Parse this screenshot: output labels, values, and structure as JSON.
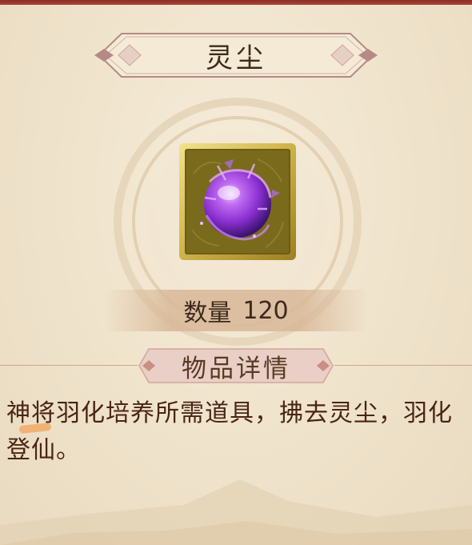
{
  "item": {
    "name": "灵尘",
    "quantity_label": "数量",
    "quantity_value": "120"
  },
  "details": {
    "header": "物品详情",
    "description": "神将羽化培养所需道具，拂去灵尘，羽化登仙。"
  },
  "colors": {
    "border_red": "#8a2e26",
    "parchment": "#efe3cc",
    "title_text": "#3f2a1b",
    "description_text": "#4a2416",
    "orb_purple": "#9b3ce0",
    "frame_gold": "#d8c25a"
  },
  "icons": {
    "item_icon": "purple-orb-icon"
  }
}
